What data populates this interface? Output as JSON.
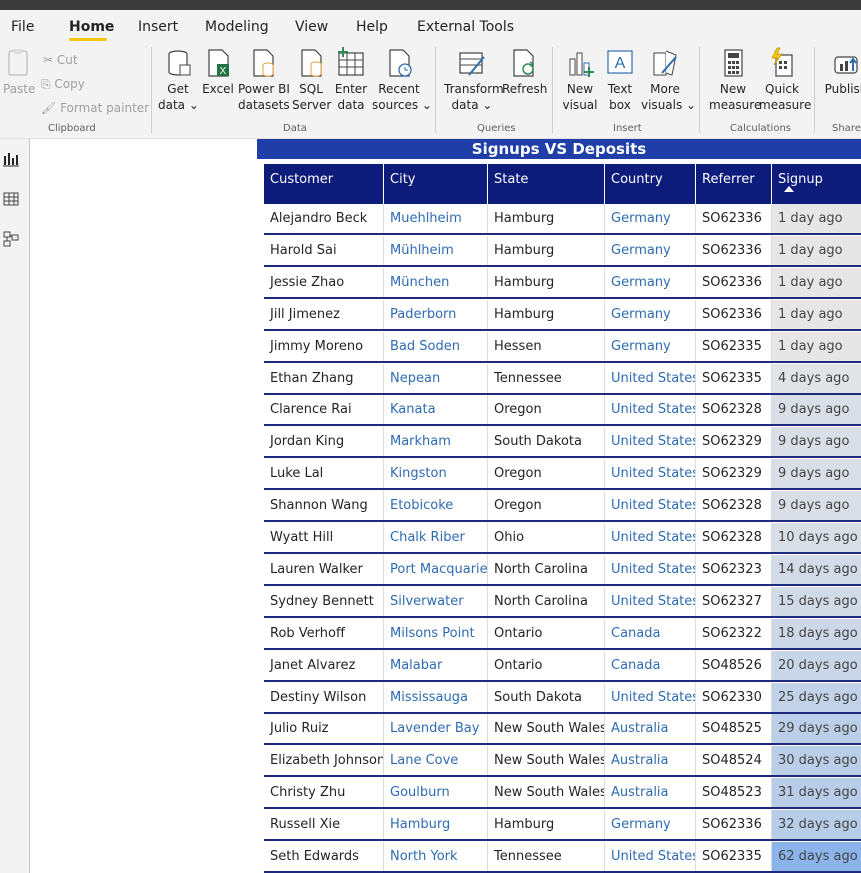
{
  "menu": {
    "items": [
      "File",
      "Home",
      "Insert",
      "Modeling",
      "View",
      "Help",
      "External Tools"
    ],
    "active": "Home"
  },
  "ribbon": {
    "clipboard": {
      "paste": "Paste",
      "cut": "Cut",
      "copy": "Copy",
      "format_painter": "Format painter",
      "group": "Clipboard"
    },
    "data": {
      "get_data": [
        "Get",
        "data ⌄"
      ],
      "excel": [
        "Excel",
        ""
      ],
      "power_bi_datasets": [
        "Power BI",
        "datasets"
      ],
      "sql_server": [
        "SQL",
        "Server"
      ],
      "enter_data": [
        "Enter",
        "data"
      ],
      "recent_sources": [
        "Recent",
        "sources ⌄"
      ],
      "group": "Data"
    },
    "queries": {
      "transform_data": [
        "Transform",
        "data ⌄"
      ],
      "refresh": [
        "Refresh",
        ""
      ],
      "group": "Queries"
    },
    "insert": {
      "new_visual": [
        "New",
        "visual"
      ],
      "text_box": [
        "Text",
        "box"
      ],
      "more_visuals": [
        "More",
        "visuals ⌄"
      ],
      "group": "Insert"
    },
    "calculations": {
      "new_measure": [
        "New",
        "measure"
      ],
      "quick_measure": [
        "Quick",
        "measure"
      ],
      "group": "Calculations"
    },
    "share": {
      "publish": [
        "Publish",
        ""
      ],
      "group": "Share"
    }
  },
  "visual": {
    "title": "Signups VS Deposits",
    "columns": [
      "Customer",
      "City",
      "State",
      "Country",
      "Referrer ID",
      "Signup"
    ],
    "rows": [
      [
        "Alejandro Beck",
        "Muehlheim",
        "Hamburg",
        "Germany",
        "SO62336",
        "1 day ago"
      ],
      [
        "Harold Sai",
        "Mühlheim",
        "Hamburg",
        "Germany",
        "SO62336",
        "1 day ago"
      ],
      [
        "Jessie Zhao",
        "München",
        "Hamburg",
        "Germany",
        "SO62336",
        "1 day ago"
      ],
      [
        "Jill Jimenez",
        "Paderborn",
        "Hamburg",
        "Germany",
        "SO62336",
        "1 day ago"
      ],
      [
        "Jimmy Moreno",
        "Bad Soden",
        "Hessen",
        "Germany",
        "SO62335",
        "1 day ago"
      ],
      [
        "Ethan Zhang",
        "Nepean",
        "Tennessee",
        "United States",
        "SO62335",
        "4 days ago"
      ],
      [
        "Clarence Rai",
        "Kanata",
        "Oregon",
        "United States",
        "SO62328",
        "9 days ago"
      ],
      [
        "Jordan King",
        "Markham",
        "South Dakota",
        "United States",
        "SO62329",
        "9 days ago"
      ],
      [
        "Luke Lal",
        "Kingston",
        "Oregon",
        "United States",
        "SO62329",
        "9 days ago"
      ],
      [
        "Shannon Wang",
        "Etobicoke",
        "Oregon",
        "United States",
        "SO62328",
        "9 days ago"
      ],
      [
        "Wyatt Hill",
        "Chalk Riber",
        "Ohio",
        "United States",
        "SO62328",
        "10 days ago"
      ],
      [
        "Lauren Walker",
        "Port Macquarie",
        "North Carolina",
        "United States",
        "SO62323",
        "14 days ago"
      ],
      [
        "Sydney Bennett",
        "Silverwater",
        "North Carolina",
        "United States",
        "SO62327",
        "15 days ago"
      ],
      [
        "Rob Verhoff",
        "Milsons Point",
        "Ontario",
        "Canada",
        "SO62322",
        "18 days ago"
      ],
      [
        "Janet Alvarez",
        "Malabar",
        "Ontario",
        "Canada",
        "SO48526",
        "20 days ago"
      ],
      [
        "Destiny Wilson",
        "Mississauga",
        "South Dakota",
        "United States",
        "SO62330",
        "25 days ago"
      ],
      [
        "Julio Ruiz",
        "Lavender Bay",
        "New South Wales",
        "Australia",
        "SO48525",
        "29 days ago"
      ],
      [
        "Elizabeth Johnson",
        "Lane Cove",
        "New South Wales",
        "Australia",
        "SO48524",
        "30 days ago"
      ],
      [
        "Christy Zhu",
        "Goulburn",
        "New South Wales",
        "Australia",
        "SO48523",
        "31 days ago"
      ],
      [
        "Russell Xie",
        "Hamburg",
        "Hamburg",
        "Germany",
        "SO62336",
        "32 days ago"
      ],
      [
        "Seth Edwards",
        "North York",
        "Tennessee",
        "United States",
        "SO62335",
        "62 days ago"
      ]
    ],
    "signup_days": [
      1,
      1,
      1,
      1,
      1,
      4,
      9,
      9,
      9,
      9,
      10,
      14,
      15,
      18,
      20,
      25,
      29,
      30,
      31,
      32,
      62
    ]
  },
  "colors": {
    "header_bg": "#0d1b7a",
    "title_bg": "#203ea8",
    "link": "#2f6bb2",
    "row_border": "#1f2a7f",
    "accent_underline": "#f2c811",
    "signup_low": "#e6e6e6",
    "signup_high": "#8ab4ea"
  }
}
